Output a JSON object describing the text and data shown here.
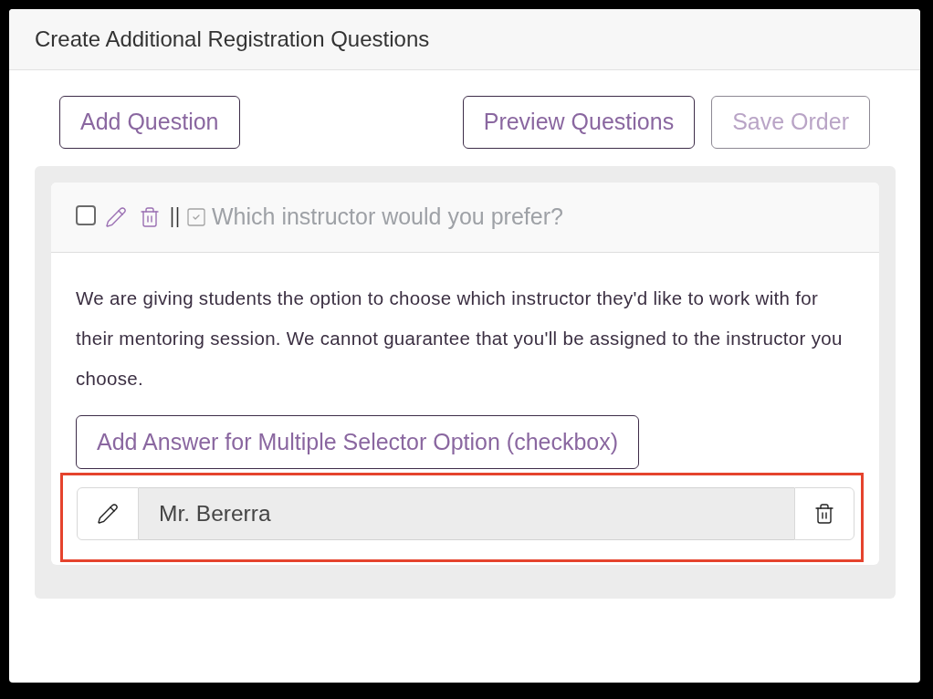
{
  "panel": {
    "title": "Create Additional Registration Questions"
  },
  "actions": {
    "left": [
      {
        "label": "Add Question",
        "disabled": false
      }
    ],
    "right": [
      {
        "label": "Preview Questions",
        "disabled": false
      },
      {
        "label": "Save Order",
        "disabled": true
      }
    ]
  },
  "questions": [
    {
      "selected": false,
      "kind": "checkbox",
      "title": "Which instructor would you prefer?",
      "description": "We are giving students the option to choose which instructor they'd like to work with for their mentoring session. We cannot guarantee that you'll be assigned to the instructor you choose.",
      "add_answer_button": "Add Answer for Multiple Selector Option (checkbox)",
      "answers": [
        {
          "value": "Mr. Bererra",
          "highlighted": true
        }
      ]
    }
  ]
}
